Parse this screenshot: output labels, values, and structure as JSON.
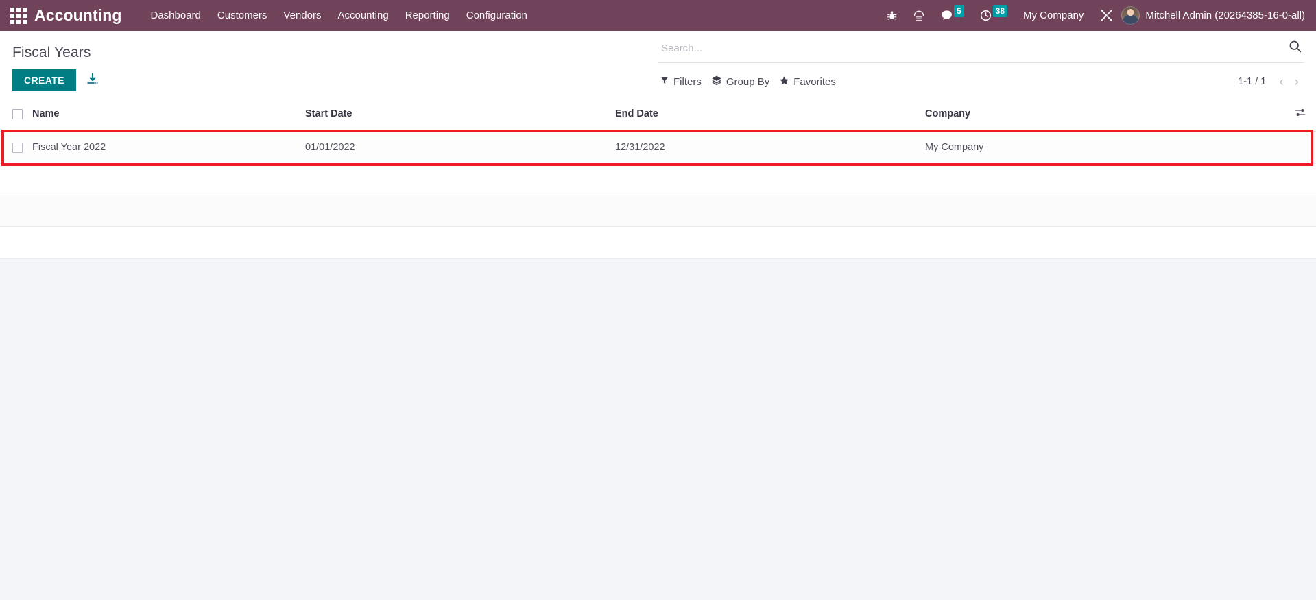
{
  "navbar": {
    "apps_icon": "apps-grid-icon",
    "brand": "Accounting",
    "menu_items": [
      {
        "label": "Dashboard"
      },
      {
        "label": "Customers"
      },
      {
        "label": "Vendors"
      },
      {
        "label": "Accounting"
      },
      {
        "label": "Reporting"
      },
      {
        "label": "Configuration"
      }
    ],
    "systray": {
      "debug_icon": "bug-icon",
      "phone_icon": "phone-keypad-icon",
      "messages_icon": "chat-bubble-icon",
      "messages_count": "5",
      "activities_icon": "clock-icon",
      "activities_count": "38",
      "company": "My Company",
      "tools_icon": "wrench-screwdriver-icon",
      "avatar": "user-avatar",
      "user": "Mitchell Admin (20264385-16-0-all)"
    },
    "background_color": "#71435b",
    "badge_color": "#00a0a8"
  },
  "control_panel": {
    "title": "Fiscal Years",
    "create_label": "CREATE",
    "create_color": "#017e84",
    "import_icon": "import-download-icon",
    "search": {
      "placeholder": "Search...",
      "value": "",
      "search_icon": "search-icon"
    },
    "filter_buttons": [
      {
        "label": "Filters",
        "icon": "funnel-icon"
      },
      {
        "label": "Group By",
        "icon": "layers-icon"
      },
      {
        "label": "Favorites",
        "icon": "star-icon"
      }
    ],
    "pager": {
      "value": "1-1 / 1",
      "prev_icon": "chevron-left-icon",
      "next_icon": "chevron-right-icon"
    }
  },
  "list_view": {
    "columns": [
      {
        "key": "name",
        "label": "Name"
      },
      {
        "key": "start_date",
        "label": "Start Date"
      },
      {
        "key": "end_date",
        "label": "End Date"
      },
      {
        "key": "company",
        "label": "Company"
      }
    ],
    "optional_columns_icon": "sliders-icon",
    "rows": [
      {
        "name": "Fiscal Year 2022",
        "start_date": "01/01/2022",
        "end_date": "12/31/2022",
        "company": "My Company"
      }
    ],
    "highlight": {
      "color": "#ed1c24",
      "target": "fiscal-year-2022-row"
    }
  }
}
